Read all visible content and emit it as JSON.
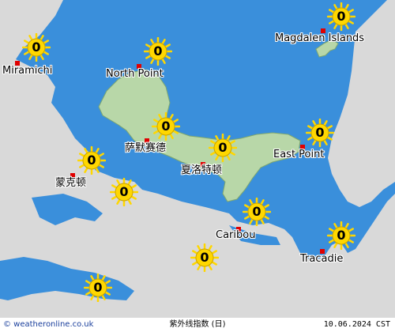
{
  "map": {
    "colors": {
      "water": "#3a8fdb",
      "mainland": "#d9d9d9",
      "island": "#b8d7a8",
      "sun": "#ffd700",
      "city_dot": "#e00000"
    },
    "cities": [
      {
        "id": "miramichi",
        "name": "Miramichi"
      },
      {
        "id": "north-point",
        "name": "North Point"
      },
      {
        "id": "magdalen-islands",
        "name": "Magdalen Islands"
      },
      {
        "id": "summerside",
        "name": "萨默赛德"
      },
      {
        "id": "charlottetown",
        "name": "夏洛特顿"
      },
      {
        "id": "east-point",
        "name": "East Point"
      },
      {
        "id": "moncton",
        "name": "蒙克顿"
      },
      {
        "id": "caribou",
        "name": "Caribou"
      },
      {
        "id": "tracadie",
        "name": "Tracadie"
      }
    ],
    "uv_markers": [
      {
        "id": "miramichi",
        "value": "0"
      },
      {
        "id": "north-point",
        "value": "0"
      },
      {
        "id": "magdalen-islands",
        "value": "0"
      },
      {
        "id": "summerside",
        "value": "0"
      },
      {
        "id": "central-pei",
        "value": "0"
      },
      {
        "id": "east-point",
        "value": "0"
      },
      {
        "id": "west",
        "value": "0"
      },
      {
        "id": "moncton-east",
        "value": "0"
      },
      {
        "id": "caribou",
        "value": "0"
      },
      {
        "id": "tracadie",
        "value": "0"
      },
      {
        "id": "south",
        "value": "0"
      },
      {
        "id": "southwest",
        "value": "0"
      }
    ]
  },
  "footer": {
    "credit": "© weatheronline.co.uk",
    "title": "紫外线指数 (日)",
    "date": "10.06.2024 CST"
  }
}
